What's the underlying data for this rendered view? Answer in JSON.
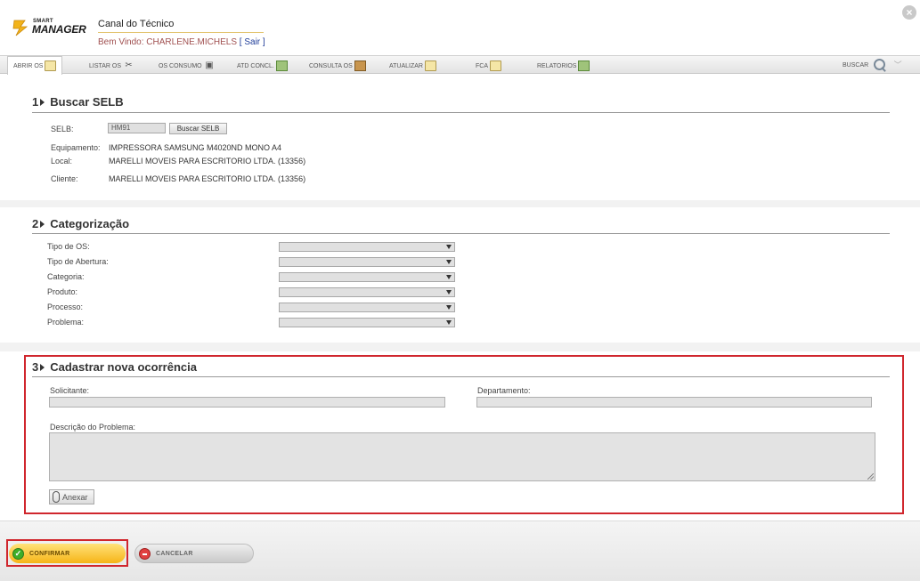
{
  "header": {
    "logo_small": "SMART",
    "logo_big": "MANAGER",
    "title": "Canal do Técnico",
    "welcome_prefix": "Bem Vindo: ",
    "username": "CHARLENE.MICHELS",
    "logout": "[ Sair ]"
  },
  "nav": {
    "items": [
      {
        "label": "ABRIR OS"
      },
      {
        "label": "LISTAR OS"
      },
      {
        "label": "OS CONSUMO"
      },
      {
        "label": "ATD CONCL."
      },
      {
        "label": "CONSULTA OS"
      },
      {
        "label": "ATUALIZAR"
      },
      {
        "label": "FCA"
      },
      {
        "label": "RELATORIOS"
      }
    ],
    "search_label": "BUSCAR"
  },
  "section1": {
    "num": "1",
    "title": "Buscar SELB",
    "selb_label": "SELB:",
    "selb_value": "HM91",
    "search_button": "Buscar SELB",
    "equipment_label": "Equipamento:",
    "equipment_value": "IMPRESSORA SAMSUNG M4020ND MONO A4",
    "local_label": "Local:",
    "local_value": "MARELLI MOVEIS PARA ESCRITORIO LTDA. (13356)",
    "client_label": "Cliente:",
    "client_value": "MARELLI MOVEIS PARA ESCRITORIO LTDA. (13356)"
  },
  "section2": {
    "num": "2",
    "title": "Categorização",
    "fields": [
      {
        "label": "Tipo de OS:"
      },
      {
        "label": "Tipo de Abertura:"
      },
      {
        "label": "Categoria:"
      },
      {
        "label": "Produto:"
      },
      {
        "label": "Processo:"
      },
      {
        "label": "Problema:"
      }
    ]
  },
  "section3": {
    "num": "3",
    "title": "Cadastrar nova ocorrência",
    "requester_label": "Solicitante:",
    "department_label": "Departamento:",
    "description_label": "Descrição do Problema:",
    "attach_label": "Anexar"
  },
  "footer": {
    "confirm": "CONFIRMAR",
    "cancel": "CANCELAR"
  }
}
